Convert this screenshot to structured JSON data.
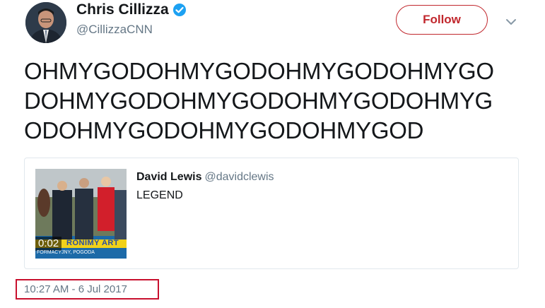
{
  "author": {
    "name": "Chris Cillizza",
    "handle": "@CillizzaCNN",
    "verified_icon": "verified-badge-icon"
  },
  "follow_button": {
    "label": "Follow",
    "color": "#c1272d"
  },
  "menu": {
    "icon": "chevron-down-icon"
  },
  "tweet": {
    "lines": [
      "OHMYGODOHMYGODOHMYGODOHMYGO",
      "DOHMYGODOHMYGODOHMYGODOHMYG",
      "ODOHMYGODOHMYGODOHMYGOD"
    ]
  },
  "quoted_tweet": {
    "author_name": "David Lewis",
    "author_handle": "@davidclewis",
    "text": "LEGEND",
    "video_duration": "0:02",
    "video_caption": "FORMACYJNY, POGODA",
    "video_overlay_text": "RONIMY ART"
  },
  "timestamp": "10:27 AM - 6 Jul 2017",
  "highlight_color": "#c8102e"
}
